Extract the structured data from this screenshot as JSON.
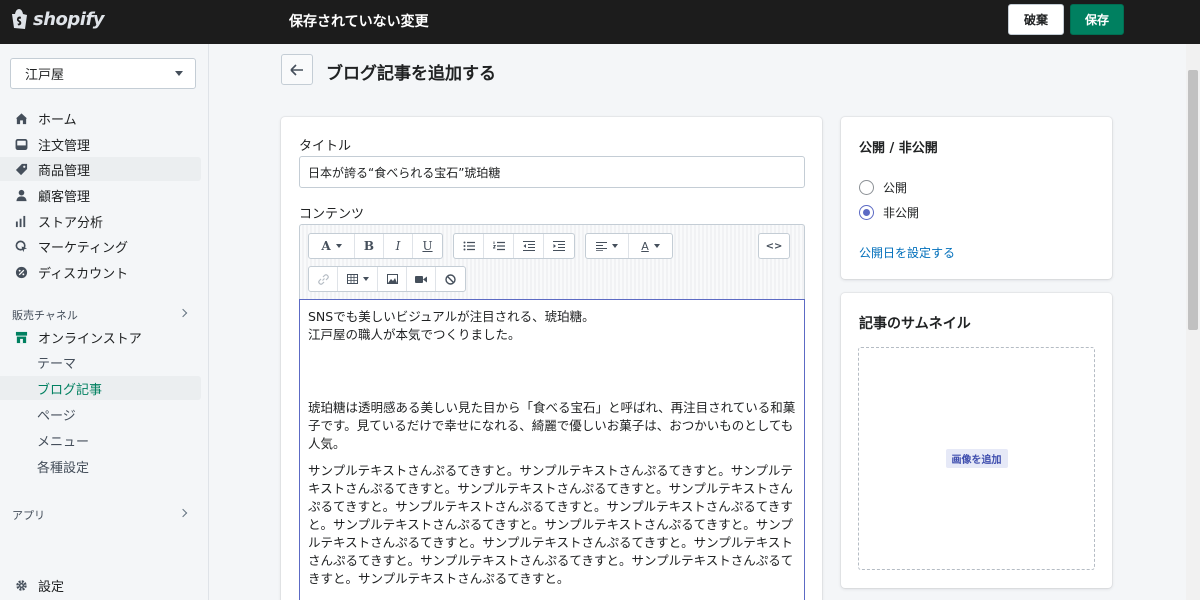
{
  "topbar": {
    "logo_text": "shopify",
    "title": "保存されていない変更",
    "discard_label": "破棄",
    "save_label": "保存"
  },
  "sidebar": {
    "store_name": "江戸屋",
    "items": [
      {
        "label": "ホーム",
        "icon": "home-icon"
      },
      {
        "label": "注文管理",
        "icon": "orders-icon"
      },
      {
        "label": "商品管理",
        "icon": "tag-icon"
      },
      {
        "label": "顧客管理",
        "icon": "customer-icon"
      },
      {
        "label": "ストア分析",
        "icon": "analytics-icon"
      },
      {
        "label": "マーケティング",
        "icon": "marketing-icon"
      },
      {
        "label": "ディスカウント",
        "icon": "discount-icon"
      }
    ],
    "sales_channels_label": "販売チャネル",
    "online_store_label": "オンラインストア",
    "online_store_sub": [
      "テーマ",
      "ブログ記事",
      "ページ",
      "メニュー",
      "各種設定"
    ],
    "apps_label": "アプリ",
    "settings_label": "設定"
  },
  "main": {
    "page_title": "ブログ記事を追加する",
    "title_label": "タイトル",
    "title_value": "日本が誇る“食べられる宝石”琥珀糖",
    "content_label": "コンテンツ",
    "content_paragraphs": [
      "SNSでも美しいビジュアルが注目される、琥珀糖。\n江戸屋の職人が本気でつくりました。",
      "",
      "琥珀糖は透明感ある美しい見た目から「食べる宝石」と呼ばれ、再注目されている和菓子です。見ているだけで幸せになれる、綺麗で優しいお菓子は、おつかいものとしても人気。",
      "サンプルテキストさんぷるてきすと。サンプルテキストさんぷるてきすと。サンプルテキストさんぷるてきすと。サンプルテキストさんぷるてきすと。サンプルテキストさんぷるてきすと。サンプルテキストさんぷるてきすと。サンプルテキストさんぷるてきすと。サンプルテキストさんぷるてきすと。サンプルテキストさんぷるてきすと。サンプルテキストさんぷるてきすと。サンプルテキストさんぷるてきすと。サンプルテキストさんぷるてきすと。サンプルテキストさんぷるてきすと。サンプルテキストさんぷるてきすと。サンプルテキストさんぷるてきすと。"
    ]
  },
  "toolbar": {
    "font_label": "A",
    "bold_label": "B",
    "italic_label": "I",
    "underline_label": "U",
    "color_label": "A",
    "code_label": "<>"
  },
  "visibility": {
    "title": "公開 / 非公開",
    "options": [
      "公開",
      "非公開"
    ],
    "selected": "非公開",
    "schedule_link": "公開日を設定する"
  },
  "thumbnail": {
    "title": "記事のサムネイル",
    "add_image_label": "画像を追加"
  },
  "colors": {
    "primary": "#008060",
    "link": "#006fbb",
    "focus": "#5c6ac4"
  }
}
